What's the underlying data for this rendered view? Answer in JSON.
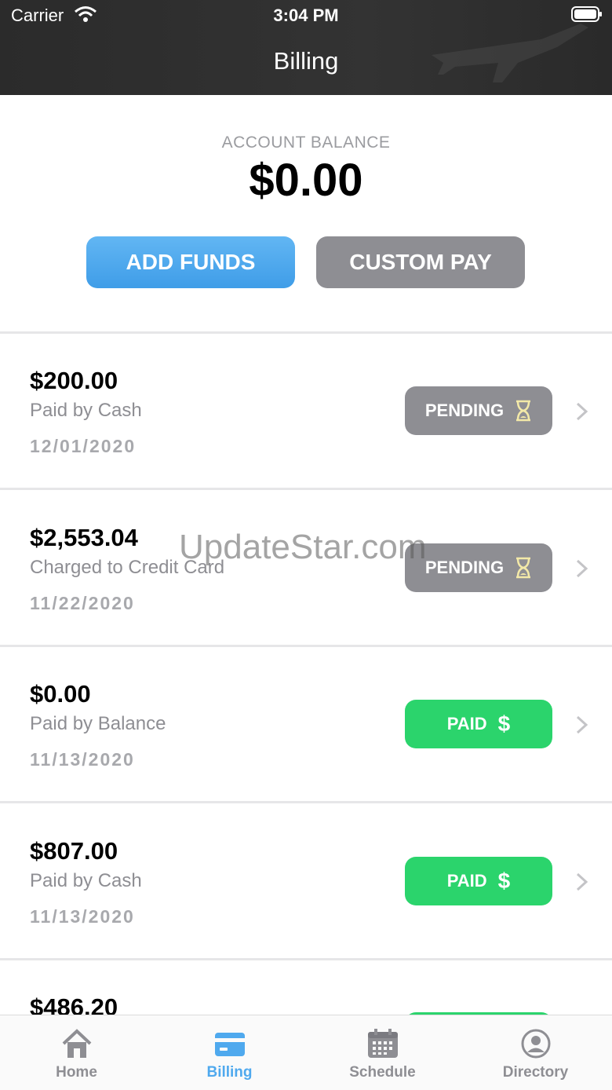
{
  "status_bar": {
    "carrier": "Carrier",
    "time": "3:04 PM"
  },
  "header": {
    "title": "Billing"
  },
  "balance": {
    "label": "ACCOUNT BALANCE",
    "value": "$0.00"
  },
  "actions": {
    "add_funds": "ADD FUNDS",
    "custom_pay": "CUSTOM PAY"
  },
  "transactions": [
    {
      "amount": "$200.00",
      "method": "Paid by Cash",
      "date": "12/01/2020",
      "status": "PENDING"
    },
    {
      "amount": "$2,553.04",
      "method": "Charged to Credit Card",
      "date": "11/22/2020",
      "status": "PENDING"
    },
    {
      "amount": "$0.00",
      "method": "Paid by Balance",
      "date": "11/13/2020",
      "status": "PAID"
    },
    {
      "amount": "$807.00",
      "method": "Paid by Cash",
      "date": "11/13/2020",
      "status": "PAID"
    },
    {
      "amount": "$486.20"
    }
  ],
  "watermark": "UpdateStar.com",
  "tabs": [
    {
      "label": "Home",
      "icon": "home-icon"
    },
    {
      "label": "Billing",
      "icon": "card-icon",
      "active": true
    },
    {
      "label": "Schedule",
      "icon": "calendar-icon"
    },
    {
      "label": "Directory",
      "icon": "person-icon"
    }
  ],
  "colors": {
    "accent": "#4fa9ee",
    "paid": "#2bd46c",
    "pending": "#8e8e93",
    "header": "#2f2f2f"
  }
}
